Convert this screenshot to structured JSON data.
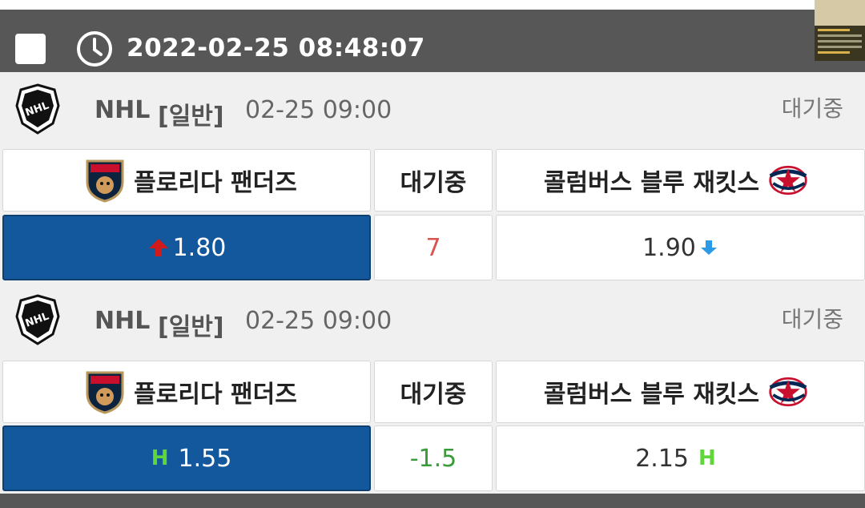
{
  "header": {
    "datetime": "2022-02-25 08:48:07",
    "checkbox_icon": "checkbox-icon",
    "clock_icon": "clock-icon"
  },
  "matches": [
    {
      "league": "NHL",
      "bet_type": "[일반]",
      "time": "02-25 09:00",
      "status": "대기중",
      "home_team": "플로리다 팬더즈",
      "away_team": "콜럼버스 블루 재킷스",
      "middle": "대기중",
      "home_odds": "1.80",
      "line": "7",
      "away_odds": "1.90",
      "line_color": "#d9534f"
    },
    {
      "league": "NHL",
      "bet_type": "[일반]",
      "time": "02-25 09:00",
      "status": "대기중",
      "home_team": "플로리다 팬더즈",
      "away_team": "콜럼버스 블루 재킷스",
      "middle": "대기중",
      "home_handicap_badge": "H",
      "home_odds": "1.55",
      "line": "-1.5",
      "away_odds": "2.15",
      "away_handicap_badge": "H",
      "line_color": "#3a9b3a"
    }
  ],
  "colors": {
    "header_bg": "#575757",
    "selected_odds_bg": "#13589c",
    "up_arrow": "#d11b1b",
    "down_arrow": "#2b9be8",
    "handicap_badge": "#5fd63a"
  }
}
